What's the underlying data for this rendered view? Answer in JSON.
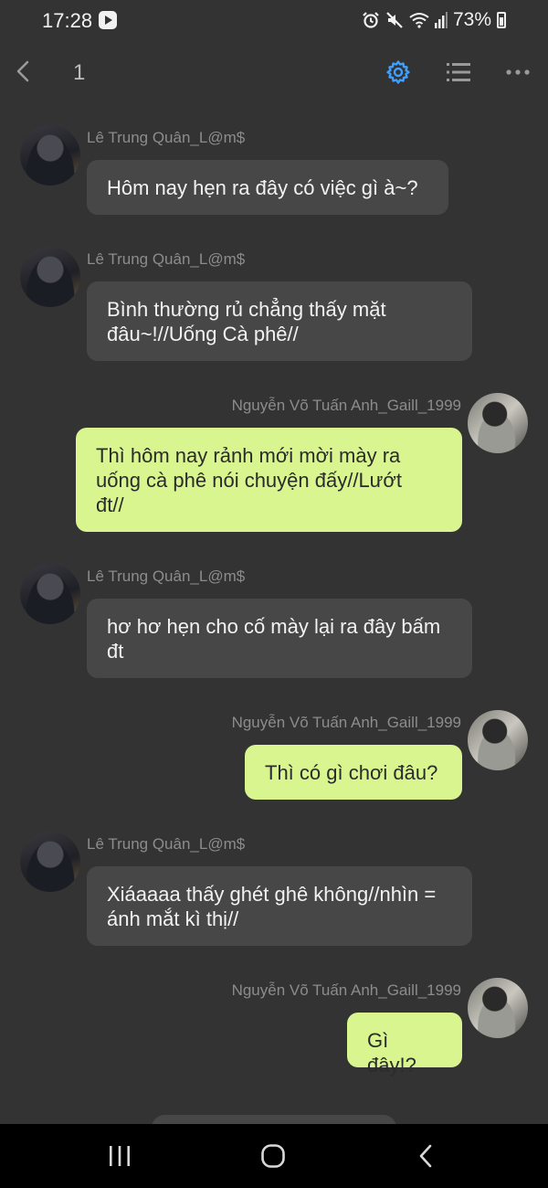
{
  "status_bar": {
    "time": "17:28",
    "battery": "73%",
    "icons": [
      "youtube-icon",
      "alarm-icon",
      "mute-icon",
      "wifi-icon",
      "signal-icon",
      "battery-icon"
    ]
  },
  "toolbar": {
    "title": "1",
    "accent_color": "#3ea0ff",
    "icons": [
      "chevron-left-icon",
      "gear-icon",
      "list-icon",
      "more-icon"
    ]
  },
  "messages": [
    {
      "sender": "Lê Trung Quân_L@m$",
      "direction": "incoming",
      "text": "Hôm nay hẹn ra đây có việc gì à~?"
    },
    {
      "sender": "Lê Trung Quân_L@m$",
      "direction": "incoming",
      "text": "Bình thường rủ chẳng thấy mặt\nđâu~!//Uống Cà phê//"
    },
    {
      "sender": "Nguyễn Võ Tuấn Anh_Gaill_1999",
      "direction": "outgoing",
      "text": "Thì hôm nay rảnh mới mời mày ra\nuống cà phê nói chuyện đấy//Lướt\nđt//"
    },
    {
      "sender": "Lê Trung Quân_L@m$",
      "direction": "incoming",
      "text": "hơ hơ hẹn cho cố mày lại ra đây bấm\nđt"
    },
    {
      "sender": "Nguyễn Võ Tuấn Anh_Gaill_1999",
      "direction": "outgoing",
      "text": "Thì có gì chơi đâu?"
    },
    {
      "sender": "Lê Trung Quân_L@m$",
      "direction": "incoming",
      "text": "Xiáaaaa thấy ghét ghê không//nhìn =\nánh mắt kì thị//"
    },
    {
      "sender": "Nguyễn Võ Tuấn Anh_Gaill_1999",
      "direction": "outgoing",
      "text": "Gì đây!?"
    }
  ],
  "colors": {
    "background": "#333333",
    "incoming_bubble": "#474747",
    "outgoing_bubble": "#d8f58f"
  },
  "nav_bar": {
    "icons": [
      "recents-icon",
      "home-icon",
      "back-icon"
    ]
  }
}
